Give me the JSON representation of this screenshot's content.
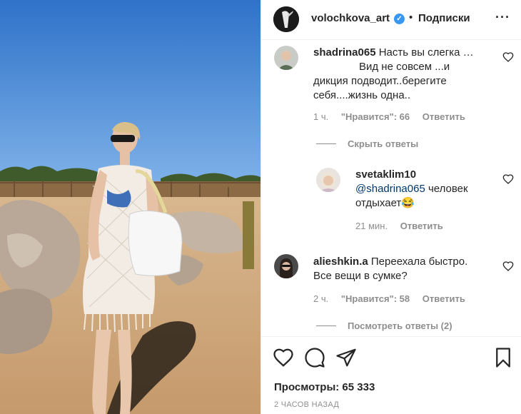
{
  "header": {
    "username": "volochkova_art",
    "verified_badge": "✓",
    "separator": "•",
    "follow_label": "Подписки",
    "more_label": "···"
  },
  "comments": [
    {
      "username": "shadrina065",
      "text": "Насть вы слегка …      Вид не совсем ...и дикция подводит..берегите себя....жизнь одна..",
      "line1": "Насть вы слегка …",
      "line2": "Вид не совсем ...и",
      "line3": "дикция подводит..берегите",
      "line4": "себя....жизнь одна..",
      "time": "1 ч.",
      "likes": "\"Нравится\": 66",
      "reply_label": "Ответить",
      "toggle_label": "Скрыть ответы"
    },
    {
      "username": "svetaklim10",
      "mention": "@shadrina065",
      "text_rest": " человек",
      "line2": "отдыхает😂",
      "time": "21 мин.",
      "reply_label": "Ответить"
    },
    {
      "username": "alieshkin.a",
      "line1": "Переехала быстро.",
      "line2": "Все вещи в сумке?",
      "time": "2 ч.",
      "likes": "\"Нравится\": 58",
      "reply_label": "Ответить",
      "toggle_label": "Посмотреть ответы (2)"
    }
  ],
  "footer": {
    "views": "Просмотры: 65 333",
    "posted": "2 ЧАСОВ НАЗАД"
  },
  "colors": {
    "text": "#262626",
    "muted": "#8e8e8e",
    "verified": "#3897f0",
    "mention": "#00376b",
    "sky": "#3a7fd0",
    "sand": "#c9a57c"
  },
  "icons": [
    "like-icon",
    "comment-icon",
    "share-icon",
    "save-icon",
    "heart-icon",
    "more-icon"
  ]
}
